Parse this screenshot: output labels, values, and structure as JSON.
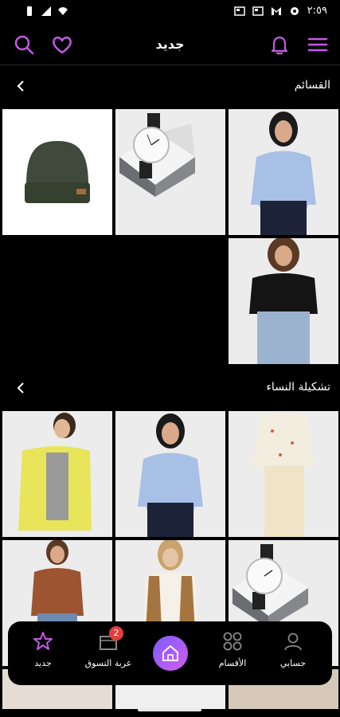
{
  "status_bar": {
    "time": "٢:٥٩"
  },
  "app_bar": {
    "title": "جديد"
  },
  "sections": [
    {
      "label": "القسائم"
    },
    {
      "label": "تشكيلة النساء"
    }
  ],
  "bottom_nav": {
    "items": [
      {
        "label": "حسابي",
        "icon": "person-icon"
      },
      {
        "label": "الأقسام",
        "icon": "grid-icon"
      },
      {
        "label": "",
        "icon": "home-icon"
      },
      {
        "label": "عربة التسوق",
        "icon": "cart-icon",
        "badge": "2"
      },
      {
        "label": "جديد",
        "icon": "star-icon"
      }
    ]
  },
  "colors": {
    "accent": "#c458e6",
    "background": "#000000",
    "badge": "#e0413f"
  }
}
